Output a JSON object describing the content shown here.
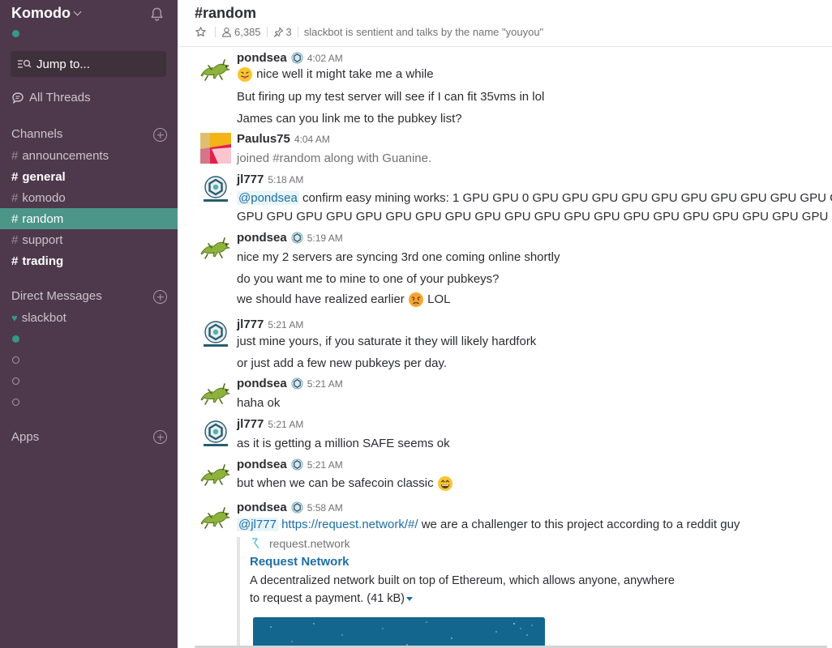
{
  "sidebar": {
    "team_name": "Komodo",
    "jump_label": "Jump to...",
    "all_threads": "All Threads",
    "channels_title": "Channels",
    "channels": [
      {
        "name": "announcements",
        "bold": false,
        "active": false
      },
      {
        "name": "general",
        "bold": true,
        "active": false
      },
      {
        "name": "komodo",
        "bold": false,
        "active": false
      },
      {
        "name": "random",
        "bold": false,
        "active": true
      },
      {
        "name": "support",
        "bold": false,
        "active": false
      },
      {
        "name": "trading",
        "bold": true,
        "active": false
      }
    ],
    "dm_title": "Direct Messages",
    "dms": [
      {
        "name": "slackbot",
        "status": "heart"
      },
      {
        "name": "",
        "status": "online"
      },
      {
        "name": "",
        "status": "offline"
      },
      {
        "name": "",
        "status": "offline"
      },
      {
        "name": "",
        "status": "offline"
      }
    ],
    "apps_title": "Apps",
    "hash": "#"
  },
  "header": {
    "channel_title": "#random",
    "member_count": "6,385",
    "pinned_count": "3",
    "topic": "slackbot is sentient and talks by the name \"youyou\""
  },
  "messages": [
    {
      "author": "pondsea",
      "time": "4:02 AM",
      "avatar": "gecko",
      "lines": [
        "nice well it might take me a while",
        "But firing up my test server will see if I can fit 35vms in lol",
        "James can you link me to the pubkey list?"
      ]
    },
    {
      "author": "Paulus75",
      "time": "4:04 AM",
      "avatar": "paulus",
      "lines": [
        "joined #random along with Guanine."
      ]
    },
    {
      "author": "jl777",
      "time": "5:18 AM",
      "avatar": "komodo",
      "mention": "@pondsea",
      "lines": [
        "confirm easy mining works: 1 GPU GPU 0 GPU GPU GPU GPU GPU GPU GPU GPU GPU GPU GPU GPU",
        "GPU GPU GPU GPU GPU GPU GPU GPU GPU GPU GPU GPU GPU GPU GPU GPU GPU GPU GPU GPU GPU GPU"
      ]
    },
    {
      "author": "pondsea",
      "time": "5:19 AM",
      "avatar": "gecko",
      "lines": [
        "nice my 2 servers are syncing 3rd one coming online shortly",
        "do you want me to mine to one of your pubkeys?",
        "we should have realized earlier",
        "LOL"
      ]
    },
    {
      "author": "jl777",
      "time": "5:21 AM",
      "avatar": "komodo",
      "lines": [
        "just mine yours, if you saturate it they will likely hardfork",
        "or just add a few new pubkeys per day."
      ]
    },
    {
      "author": "pondsea",
      "time": "5:21 AM",
      "avatar": "gecko",
      "lines": [
        "haha ok"
      ]
    },
    {
      "author": "jl777",
      "time": "5:21 AM",
      "avatar": "komodo",
      "lines": [
        "as it is getting a million SAFE seems ok"
      ]
    },
    {
      "author": "pondsea",
      "time": "5:21 AM",
      "avatar": "gecko",
      "lines": [
        "but when we can be safecoin classic"
      ]
    },
    {
      "author": "pondsea",
      "time": "5:58 AM",
      "avatar": "gecko",
      "mention": "@jl777",
      "link": "https://request.network/#/",
      "lines": [
        "we are a challenger to this project according  to a reddit guy"
      ]
    }
  ],
  "attachment": {
    "service": "request.network",
    "title": "Request Network",
    "text_line1": "A decentralized network built on top of Ethereum, which allows anyone, anywhere",
    "text_line2": "to request a payment. (41 kB)"
  },
  "colors": {
    "sidebar_bg": "#4d394b",
    "active_channel": "#4c9689",
    "presence": "#38978d",
    "link": "#1d6ea5"
  }
}
